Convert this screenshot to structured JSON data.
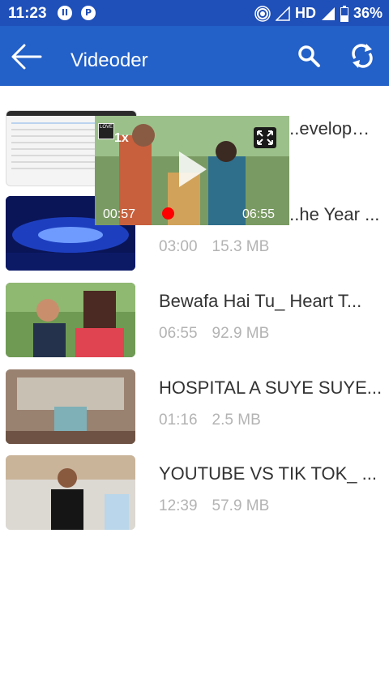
{
  "status_bar": {
    "time": "11:23",
    "network": "HD",
    "battery": "36%"
  },
  "app_bar": {
    "title": "Videoder"
  },
  "mini_player": {
    "speed": "1x",
    "logo_text": "LOVE",
    "current_time": "00:57",
    "duration": "06:55"
  },
  "videos": [
    {
      "title": "...evelopme...",
      "duration": "",
      "size": ""
    },
    {
      "title": "...he Year ...",
      "duration": "03:00",
      "size": "15.3 MB"
    },
    {
      "title": "Bewafa Hai Tu_ Heart T...",
      "duration": "06:55",
      "size": "92.9 MB"
    },
    {
      "title": "HOSPITAL A SUYE SUYE...",
      "duration": "01:16",
      "size": "2.5 MB"
    },
    {
      "title": "YOUTUBE VS TIK TOK_ ...",
      "duration": "12:39",
      "size": "57.9 MB"
    }
  ],
  "colors": {
    "status_bar": "#1f4fb8",
    "app_bar": "#2360c8",
    "meta_text": "#b3b3b3"
  }
}
